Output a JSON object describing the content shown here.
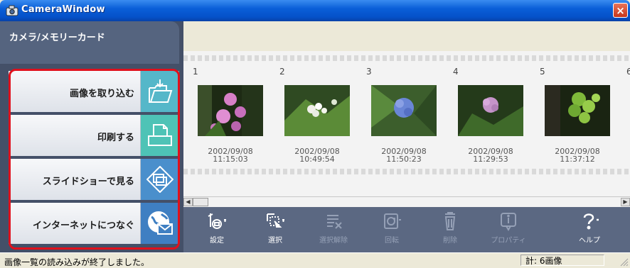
{
  "window": {
    "title": "CameraWindow",
    "close_label": "×"
  },
  "sidebar": {
    "header": "カメラ/メモリーカード",
    "items": [
      {
        "label": "画像を取り込む",
        "icon": "import-folder-icon",
        "color": "#55b7c9"
      },
      {
        "label": "印刷する",
        "icon": "print-icon",
        "color": "#4ec3b6"
      },
      {
        "label": "スライドショーで見る",
        "icon": "slideshow-icon",
        "color": "#4a8fcc"
      },
      {
        "label": "インターネットにつなぐ",
        "icon": "internet-mail-icon",
        "color": "#3f7fc2"
      }
    ]
  },
  "thumbnails": [
    {
      "number": "1",
      "date": "2002/09/08",
      "time": "11:15:03"
    },
    {
      "number": "2",
      "date": "2002/09/08",
      "time": "10:49:54"
    },
    {
      "number": "3",
      "date": "2002/09/08",
      "time": "11:50:23"
    },
    {
      "number": "4",
      "date": "2002/09/08",
      "time": "11:29:53"
    },
    {
      "number": "5",
      "date": "2002/09/08",
      "time": "11:37:12"
    },
    {
      "number": "6",
      "date": "",
      "time": ""
    }
  ],
  "toolbar": [
    {
      "label": "設定",
      "enabled": true
    },
    {
      "label": "選択",
      "enabled": true
    },
    {
      "label": "選択解除",
      "enabled": false
    },
    {
      "label": "回転",
      "enabled": false
    },
    {
      "label": "削除",
      "enabled": false
    },
    {
      "label": "プロパティ",
      "enabled": false
    },
    {
      "label": "ヘルプ",
      "enabled": true
    }
  ],
  "status": {
    "message": "画像一覧の読み込みが終了しました。",
    "count": "計: 6画像"
  },
  "colors": {
    "highlight_frame": "#e0101c",
    "toolbar_bg": "#5b6882",
    "sidebar_bg": "#445068"
  }
}
